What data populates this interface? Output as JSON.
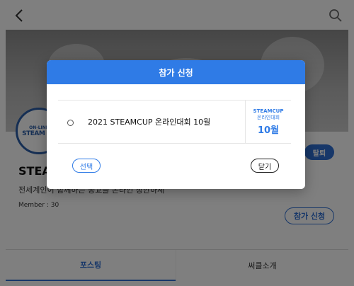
{
  "modal": {
    "title": "참가 신청",
    "event": {
      "title": "2021 STEAMCUP 온라인대회 10월",
      "badge_line1": "STEAMCUP",
      "badge_line2": "온라인대회",
      "badge_month": "10월"
    },
    "select_label": "선택",
    "close_label": "닫기"
  },
  "club": {
    "logo_line1": "ON-LINE",
    "logo_line2": "STEAM CU",
    "name": "STEA",
    "description": "전세계인이 함께하는 공교를 온라인 창안하세",
    "member": "Member : 30",
    "quit_label": "탈퇴",
    "join_label": "참가 신청"
  },
  "tabs": [
    {
      "label": "포스팅"
    },
    {
      "label": "써클소개"
    }
  ],
  "colors": {
    "accent": "#2f7be6",
    "overlay": "rgba(0,0,0,0.5)"
  }
}
